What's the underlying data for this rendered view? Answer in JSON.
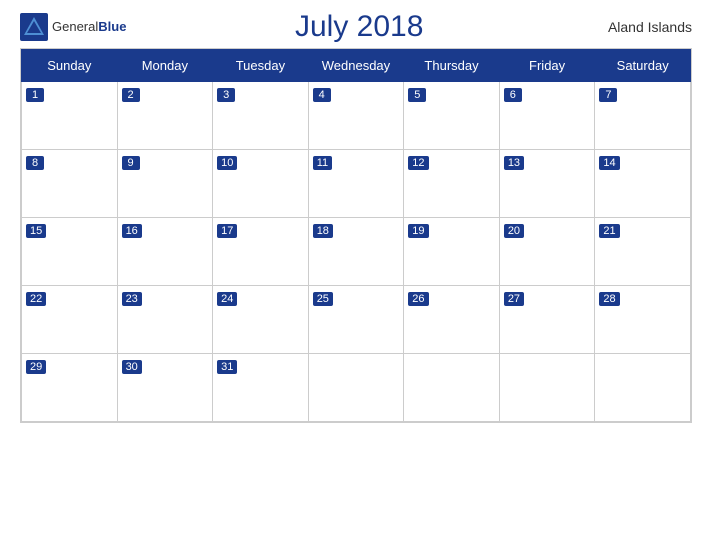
{
  "header": {
    "logo_general": "General",
    "logo_blue": "Blue",
    "title": "July 2018",
    "region": "Aland Islands"
  },
  "days_of_week": [
    "Sunday",
    "Monday",
    "Tuesday",
    "Wednesday",
    "Thursday",
    "Friday",
    "Saturday"
  ],
  "weeks": [
    [
      1,
      2,
      3,
      4,
      5,
      6,
      7
    ],
    [
      8,
      9,
      10,
      11,
      12,
      13,
      14
    ],
    [
      15,
      16,
      17,
      18,
      19,
      20,
      21
    ],
    [
      22,
      23,
      24,
      25,
      26,
      27,
      28
    ],
    [
      29,
      30,
      31,
      null,
      null,
      null,
      null
    ]
  ]
}
